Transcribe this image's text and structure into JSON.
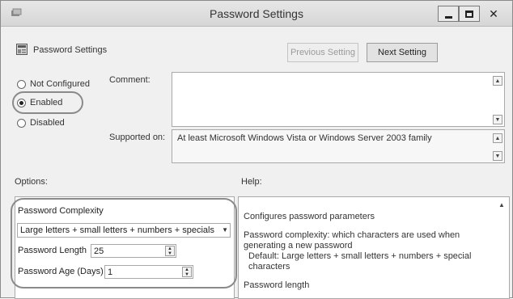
{
  "window": {
    "title": "Password Settings"
  },
  "header": {
    "policy_title": "Password Settings",
    "prev_label": "Previous Setting",
    "next_label": "Next Setting"
  },
  "state": {
    "options": [
      {
        "label": "Not Configured",
        "selected": false
      },
      {
        "label": "Enabled",
        "selected": true
      },
      {
        "label": "Disabled",
        "selected": false
      }
    ]
  },
  "comment": {
    "label": "Comment:",
    "value": ""
  },
  "supported": {
    "label": "Supported on:",
    "value": "At least Microsoft Windows Vista or Windows Server 2003 family"
  },
  "sections": {
    "options_label": "Options:",
    "help_label": "Help:"
  },
  "options_panel": {
    "complexity_label": "Password Complexity",
    "complexity_value": "Large letters + small letters + numbers + specials",
    "length_label": "Password Length",
    "length_value": "25",
    "age_label": "Password Age (Days)",
    "age_value": "1"
  },
  "help": {
    "line1": "Configures password parameters",
    "line2": "Password complexity: which characters are used when generating a new password",
    "line3": "Default: Large letters + small letters + numbers + special characters",
    "line4": "Password length"
  },
  "icons": {
    "app": "app-icon",
    "policy": "policy-icon",
    "minimize": "minimize-icon",
    "maximize": "maximize-icon",
    "close": "close-icon"
  }
}
